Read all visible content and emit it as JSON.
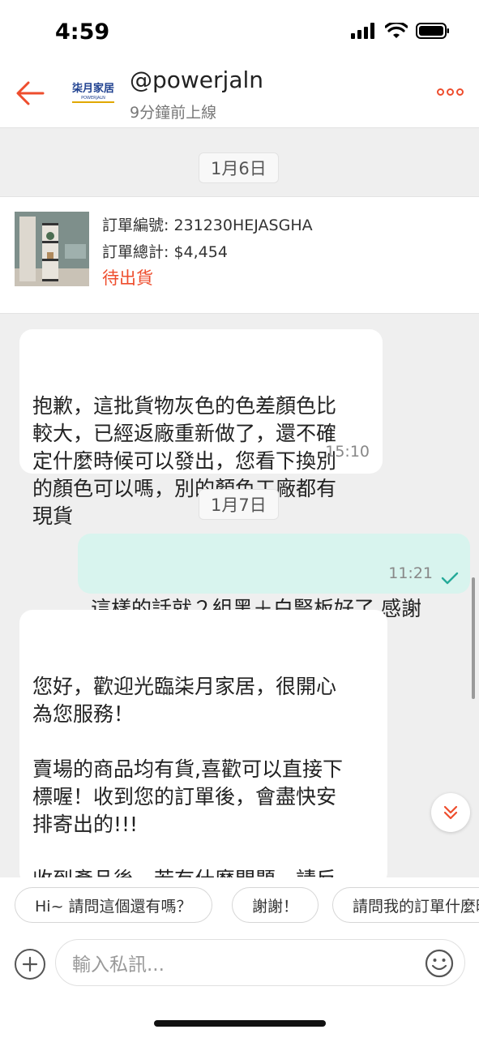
{
  "status_bar": {
    "time": "4:59"
  },
  "header": {
    "avatar_logo": "柒月家居",
    "avatar_sub": "POWERJALN",
    "username": "@powerjaln",
    "status": "9分鐘前上線"
  },
  "dates": [
    "1月6日",
    "1月7日"
  ],
  "order": {
    "number_line": "訂單編號: 231230HEJASGHA",
    "total_line": "訂單總計: $4,454",
    "status": "待出貨"
  },
  "messages": [
    {
      "direction": "in",
      "text": "抱歉，這批貨物灰色的色差顏色比\n較大，已經返廠重新做了，還不確\n定什麼時候可以發出，您看下換別\n的顏色可以嗎，別的顏色工廠都有\n現貨",
      "time": "15:10"
    },
    {
      "direction": "out",
      "text": "這樣的話就２組黑＋白豎板好了 感謝",
      "time": "11:21"
    },
    {
      "direction": "in",
      "text": "您好，歡迎光臨柒月家居，很開心\n為您服務！\n\n賣場的商品均有貨,喜歡可以直接下\n標喔！收到您的訂單後，會盡快安\n排寄出的!!!\n\n收到產品後，若有什麼問題，請反\n饋留言，看到留言後，我會第一時\n間為您處理"
    }
  ],
  "quick_replies": [
    "Hi~ 請問這個還有嗎？",
    "謝謝！",
    "請問我的訂單什麼時候出貨"
  ],
  "input": {
    "placeholder": "輸入私訊..."
  },
  "colors": {
    "accent": "#ee4d2d",
    "outgoing_bubble": "#d8f4ee",
    "read_check": "#26aa99"
  }
}
